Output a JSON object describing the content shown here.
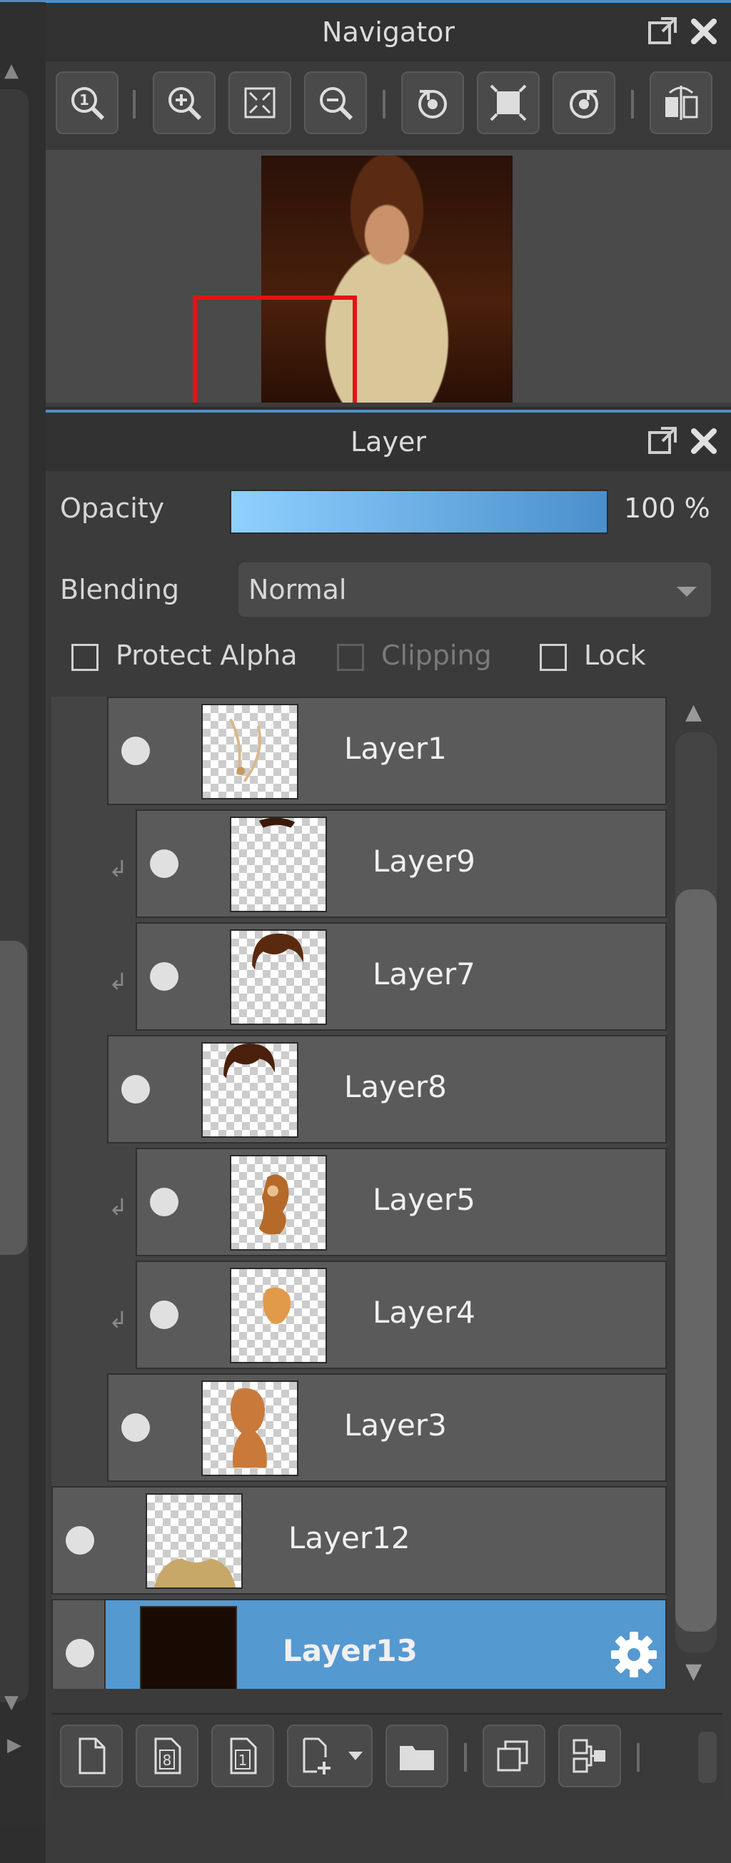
{
  "navigator": {
    "title": "Navigator",
    "toolbar": [
      {
        "icon": "zoom-actual-icon"
      },
      {
        "icon": "zoom-in-icon"
      },
      {
        "icon": "fit-screen-icon"
      },
      {
        "icon": "zoom-out-icon"
      },
      {
        "icon": "rotate-left-icon"
      },
      {
        "icon": "fit-window-icon"
      },
      {
        "icon": "rotate-right-icon"
      },
      {
        "icon": "flip-horizontal-icon"
      }
    ]
  },
  "layer_panel": {
    "title": "Layer",
    "opacity_label": "Opacity",
    "opacity_value": "100 %",
    "opacity_fraction": 1.0,
    "blending_label": "Blending",
    "blending_value": "Normal",
    "protect_alpha_label": "Protect Alpha",
    "clipping_label": "Clipping",
    "lock_label": "Lock",
    "layers": [
      {
        "name": "Layer1",
        "indent": 1,
        "clipped": false,
        "selected": false
      },
      {
        "name": "Layer9",
        "indent": 2,
        "clipped": true,
        "selected": false
      },
      {
        "name": "Layer7",
        "indent": 2,
        "clipped": true,
        "selected": false
      },
      {
        "name": "Layer8",
        "indent": 1,
        "clipped": false,
        "selected": false
      },
      {
        "name": "Layer5",
        "indent": 2,
        "clipped": true,
        "selected": false
      },
      {
        "name": "Layer4",
        "indent": 2,
        "clipped": true,
        "selected": false
      },
      {
        "name": "Layer3",
        "indent": 1,
        "clipped": false,
        "selected": false
      },
      {
        "name": "Layer12",
        "indent": 0,
        "clipped": false,
        "selected": false
      },
      {
        "name": "Layer13",
        "indent": 0,
        "clipped": false,
        "selected": true
      }
    ],
    "bottom_toolbar": [
      {
        "icon": "new-layer-icon"
      },
      {
        "icon": "new-8bit-layer-icon"
      },
      {
        "icon": "new-1bit-layer-icon"
      },
      {
        "icon": "add-layer-dropdown-icon"
      },
      {
        "icon": "new-folder-icon"
      },
      {
        "icon": "duplicate-layer-icon"
      },
      {
        "icon": "merge-layer-icon"
      }
    ]
  },
  "colors": {
    "accent": "#5599d1",
    "selection_rect": "#e01515"
  }
}
